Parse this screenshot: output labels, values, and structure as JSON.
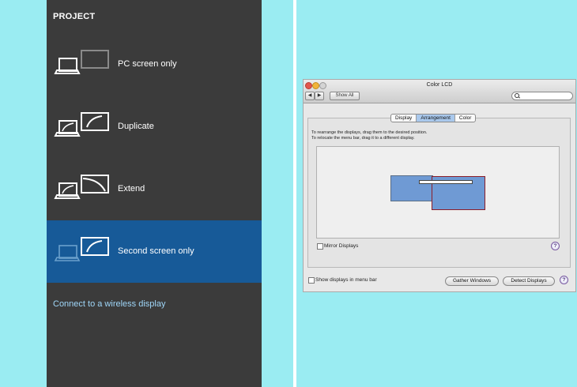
{
  "project_pane": {
    "title": "PROJECT",
    "options": [
      {
        "label": "PC screen only",
        "icon": "pc-screen-only-icon"
      },
      {
        "label": "Duplicate",
        "icon": "duplicate-icon"
      },
      {
        "label": "Extend",
        "icon": "extend-icon"
      },
      {
        "label": "Second screen only",
        "icon": "second-screen-only-icon",
        "selected": true
      }
    ],
    "wireless_link": "Connect to a wireless display",
    "colors": {
      "background": "#3b3b3b",
      "selected": "#175a98",
      "link": "#9fd6f8"
    }
  },
  "mac_window": {
    "title": "Color LCD",
    "back_label": "◀",
    "forward_label": "▶",
    "show_all": "Show All",
    "search_placeholder": "",
    "tabs": [
      {
        "label": "Display",
        "active": false
      },
      {
        "label": "Arrangement",
        "active": true
      },
      {
        "label": "Color",
        "active": false
      }
    ],
    "instruction_line1": "To rearrange the displays, drag them to the desired position.",
    "instruction_line2": "To relocate the menu bar, drag it to a different display.",
    "mirror_label": "Mirror Displays",
    "mirror_checked": false,
    "show_in_menu_bar_label": "Show displays in menu bar",
    "show_in_menu_bar_checked": false,
    "gather_windows": "Gather Windows",
    "detect_displays": "Detect Displays",
    "help_glyph": "?"
  }
}
